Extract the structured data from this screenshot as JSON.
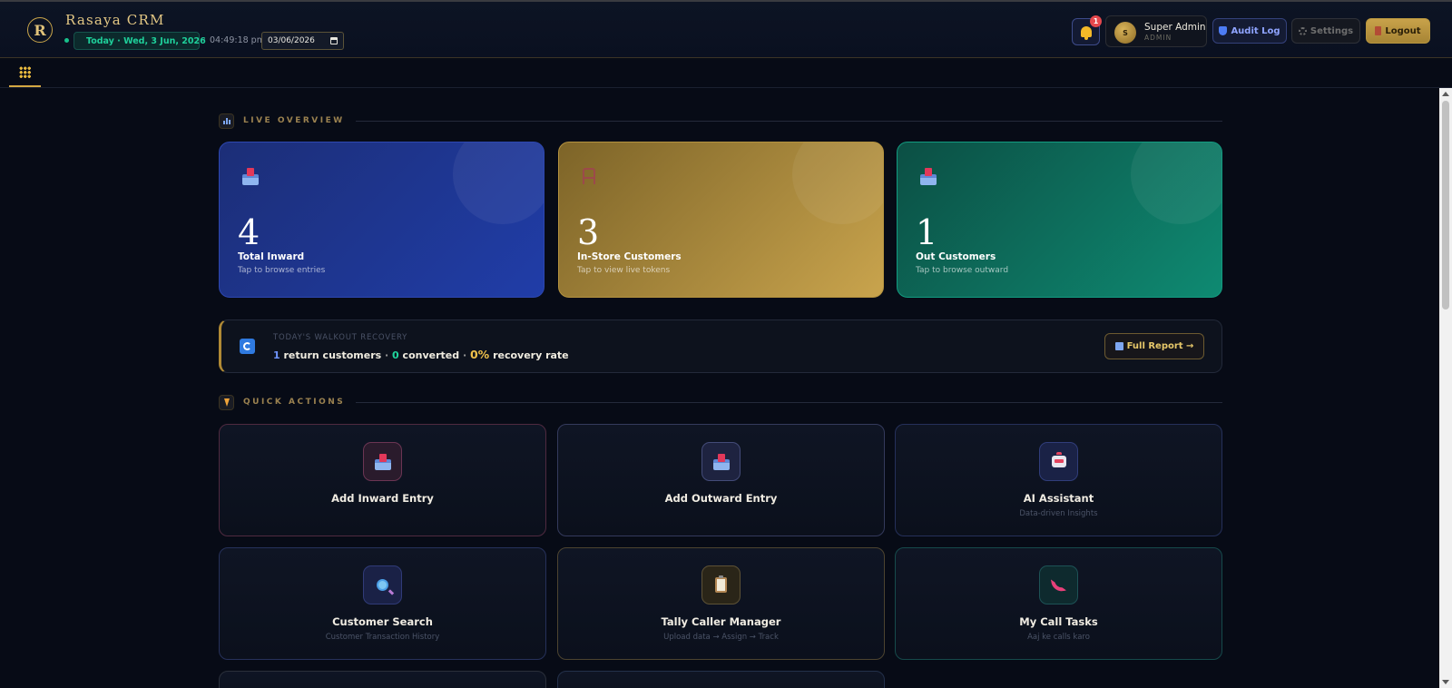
{
  "header": {
    "app_title": "Rasaya CRM",
    "logo_glyph": "R",
    "today_label": "Today · Wed, 3 Jun, 2026",
    "clock": "04:49:18 pm",
    "date_value": "03/06/2026",
    "notification_count": "1",
    "user_name": "Super Admin",
    "user_role": "ADMIN",
    "avatar_initial": "S",
    "audit_label": "Audit Log",
    "settings_label": "Settings",
    "logout_label": "Logout"
  },
  "overview": {
    "section_title": "LIVE OVERVIEW",
    "cards": [
      {
        "value": "4",
        "label": "Total Inward",
        "sub": "Tap to browse entries",
        "icon": "inbox-tray-icon",
        "color": "#203da8"
      },
      {
        "value": "3",
        "label": "In-Store Customers",
        "sub": "Tap to view live tokens",
        "icon": "chair-icon",
        "color": "#c9a44d"
      },
      {
        "value": "1",
        "label": "Out Customers",
        "sub": "Tap to browse outward",
        "icon": "outbox-tray-icon",
        "color": "#0e8a72"
      }
    ]
  },
  "recovery": {
    "kicker": "TODAY'S WALKOUT RECOVERY",
    "return_count": "1",
    "return_label": "return customers",
    "converted_count": "0",
    "converted_label": "converted",
    "rate": "0%",
    "rate_label": "recovery rate",
    "button_label": "Full Report →"
  },
  "quick_actions": {
    "section_title": "QUICK ACTIONS",
    "tiles": [
      {
        "title": "Add Inward Entry",
        "sub": "",
        "icon": "inbox-tray-icon"
      },
      {
        "title": "Add Outward Entry",
        "sub": "",
        "icon": "outbox-tray-icon"
      },
      {
        "title": "AI Assistant",
        "sub": "Data-driven Insights",
        "icon": "robot-icon"
      },
      {
        "title": "Customer Search",
        "sub": "Customer Transaction History",
        "icon": "magnifier-icon"
      },
      {
        "title": "Tally Caller Manager",
        "sub": "Upload data → Assign → Track",
        "icon": "clipboard-icon"
      },
      {
        "title": "My Call Tasks",
        "sub": "Aaj ke calls karo",
        "icon": "phone-icon"
      }
    ]
  },
  "colors": {
    "accent_gold": "#d4a843",
    "live_green": "#18c08b",
    "alert_red": "#e5484d",
    "background": "#070b16"
  }
}
